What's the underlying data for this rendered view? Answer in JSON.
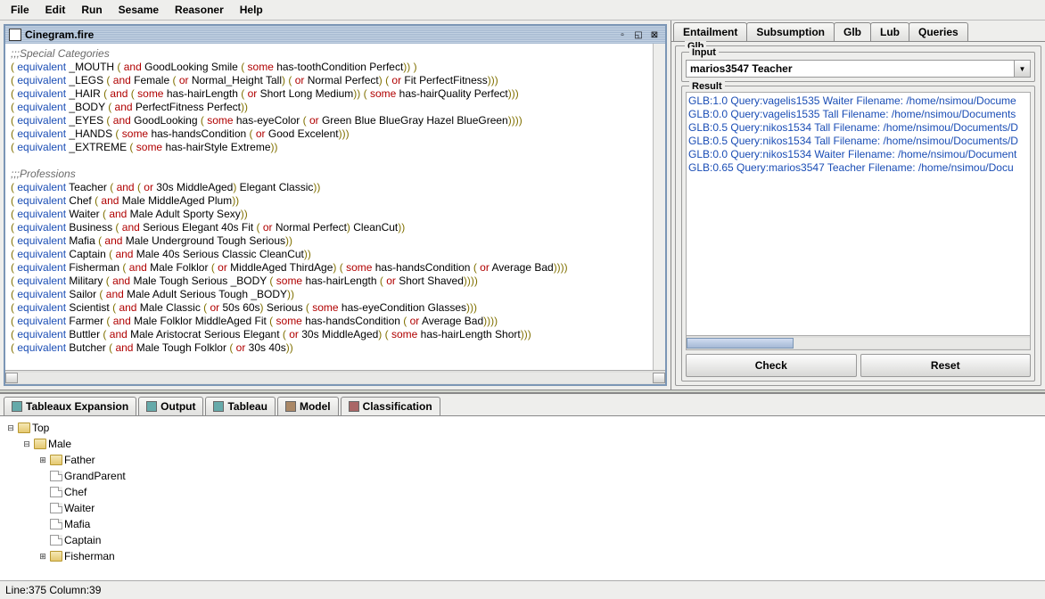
{
  "menu": [
    "File",
    "Edit",
    "Run",
    "Sesame",
    "Reasoner",
    "Help"
  ],
  "doc": {
    "title": "Cinegram.fire"
  },
  "editor_tokens": [
    [
      {
        "c": "t-comment",
        "t": ";;;Special Categories"
      }
    ],
    [
      {
        "c": "t-paren",
        "t": "( "
      },
      {
        "c": "t-kw",
        "t": "equivalent"
      },
      {
        "t": " _MOUTH "
      },
      {
        "c": "t-paren",
        "t": "( "
      },
      {
        "c": "t-op",
        "t": "and"
      },
      {
        "t": " GoodLooking Smile "
      },
      {
        "c": "t-paren",
        "t": "( "
      },
      {
        "c": "t-op",
        "t": "some"
      },
      {
        "t": " has-toothCondition Perfect"
      },
      {
        "c": "t-paren",
        "t": "))"
      },
      {
        "t": " "
      },
      {
        "c": "t-paren",
        "t": ")"
      }
    ],
    [
      {
        "c": "t-paren",
        "t": "( "
      },
      {
        "c": "t-kw",
        "t": "equivalent"
      },
      {
        "t": " _LEGS "
      },
      {
        "c": "t-paren",
        "t": "( "
      },
      {
        "c": "t-op",
        "t": "and"
      },
      {
        "t": " Female "
      },
      {
        "c": "t-paren",
        "t": "( "
      },
      {
        "c": "t-op",
        "t": "or"
      },
      {
        "t": " Normal_Height Tall"
      },
      {
        "c": "t-paren",
        "t": ")"
      },
      {
        "t": " "
      },
      {
        "c": "t-paren",
        "t": "( "
      },
      {
        "c": "t-op",
        "t": "or"
      },
      {
        "t": " Normal Perfect"
      },
      {
        "c": "t-paren",
        "t": ")"
      },
      {
        "t": " "
      },
      {
        "c": "t-paren",
        "t": "( "
      },
      {
        "c": "t-op",
        "t": "or"
      },
      {
        "t": " Fit PerfectFitness"
      },
      {
        "c": "t-paren",
        "t": ")))"
      }
    ],
    [
      {
        "c": "t-paren",
        "t": "( "
      },
      {
        "c": "t-kw",
        "t": "equivalent"
      },
      {
        "t": " _HAIR "
      },
      {
        "c": "t-paren",
        "t": "( "
      },
      {
        "c": "t-op",
        "t": "and"
      },
      {
        "t": " "
      },
      {
        "c": "t-paren",
        "t": "( "
      },
      {
        "c": "t-op",
        "t": "some"
      },
      {
        "t": " has-hairLength "
      },
      {
        "c": "t-paren",
        "t": "( "
      },
      {
        "c": "t-op",
        "t": "or"
      },
      {
        "t": " Short Long Medium"
      },
      {
        "c": "t-paren",
        "t": "))"
      },
      {
        "t": " "
      },
      {
        "c": "t-paren",
        "t": "( "
      },
      {
        "c": "t-op",
        "t": "some"
      },
      {
        "t": " has-hairQuality Perfect"
      },
      {
        "c": "t-paren",
        "t": ")))"
      }
    ],
    [
      {
        "c": "t-paren",
        "t": "( "
      },
      {
        "c": "t-kw",
        "t": "equivalent"
      },
      {
        "t": " _BODY "
      },
      {
        "c": "t-paren",
        "t": "( "
      },
      {
        "c": "t-op",
        "t": "and"
      },
      {
        "t": " PerfectFitness Perfect"
      },
      {
        "c": "t-paren",
        "t": "))"
      }
    ],
    [
      {
        "c": "t-paren",
        "t": "( "
      },
      {
        "c": "t-kw",
        "t": "equivalent"
      },
      {
        "t": " _EYES "
      },
      {
        "c": "t-paren",
        "t": "( "
      },
      {
        "c": "t-op",
        "t": "and"
      },
      {
        "t": " GoodLooking "
      },
      {
        "c": "t-paren",
        "t": "( "
      },
      {
        "c": "t-op",
        "t": "some"
      },
      {
        "t": " has-eyeColor "
      },
      {
        "c": "t-paren",
        "t": "( "
      },
      {
        "c": "t-op",
        "t": "or"
      },
      {
        "t": " Green Blue BlueGray Hazel BlueGreen"
      },
      {
        "c": "t-paren",
        "t": "))))"
      }
    ],
    [
      {
        "c": "t-paren",
        "t": "( "
      },
      {
        "c": "t-kw",
        "t": "equivalent"
      },
      {
        "t": " _HANDS "
      },
      {
        "c": "t-paren",
        "t": "( "
      },
      {
        "c": "t-op",
        "t": "some"
      },
      {
        "t": " has-handsCondition "
      },
      {
        "c": "t-paren",
        "t": "( "
      },
      {
        "c": "t-op",
        "t": "or"
      },
      {
        "t": " Good Excelent"
      },
      {
        "c": "t-paren",
        "t": ")))"
      }
    ],
    [
      {
        "c": "t-paren",
        "t": "( "
      },
      {
        "c": "t-kw",
        "t": "equivalent"
      },
      {
        "t": " _EXTREME "
      },
      {
        "c": "t-paren",
        "t": "( "
      },
      {
        "c": "t-op",
        "t": "some"
      },
      {
        "t": " has-hairStyle Extreme"
      },
      {
        "c": "t-paren",
        "t": "))"
      }
    ],
    [],
    [
      {
        "c": "t-comment",
        "t": ";;;Professions"
      }
    ],
    [
      {
        "c": "t-paren",
        "t": "( "
      },
      {
        "c": "t-kw",
        "t": "equivalent"
      },
      {
        "t": " Teacher "
      },
      {
        "c": "t-paren",
        "t": "( "
      },
      {
        "c": "t-op",
        "t": "and"
      },
      {
        "t": " "
      },
      {
        "c": "t-paren",
        "t": "( "
      },
      {
        "c": "t-op",
        "t": "or"
      },
      {
        "t": " 30s MiddleAged"
      },
      {
        "c": "t-paren",
        "t": ")"
      },
      {
        "t": " Elegant Classic"
      },
      {
        "c": "t-paren",
        "t": "))"
      }
    ],
    [
      {
        "c": "t-paren",
        "t": "( "
      },
      {
        "c": "t-kw",
        "t": "equivalent"
      },
      {
        "t": " Chef "
      },
      {
        "c": "t-paren",
        "t": "( "
      },
      {
        "c": "t-op",
        "t": "and"
      },
      {
        "t": " Male MiddleAged Plum"
      },
      {
        "c": "t-paren",
        "t": "))"
      }
    ],
    [
      {
        "c": "t-paren",
        "t": "( "
      },
      {
        "c": "t-kw",
        "t": "equivalent"
      },
      {
        "t": " Waiter "
      },
      {
        "c": "t-paren",
        "t": "( "
      },
      {
        "c": "t-op",
        "t": "and"
      },
      {
        "t": " Male Adult Sporty Sexy"
      },
      {
        "c": "t-paren",
        "t": "))"
      }
    ],
    [
      {
        "c": "t-paren",
        "t": "( "
      },
      {
        "c": "t-kw",
        "t": "equivalent"
      },
      {
        "t": " Business "
      },
      {
        "c": "t-paren",
        "t": "( "
      },
      {
        "c": "t-op",
        "t": "and"
      },
      {
        "t": " Serious Elegant 40s  Fit "
      },
      {
        "c": "t-paren",
        "t": "( "
      },
      {
        "c": "t-op",
        "t": "or"
      },
      {
        "t": " Normal Perfect"
      },
      {
        "c": "t-paren",
        "t": ")"
      },
      {
        "t": " CleanCut"
      },
      {
        "c": "t-paren",
        "t": "))"
      }
    ],
    [
      {
        "c": "t-paren",
        "t": "( "
      },
      {
        "c": "t-kw",
        "t": "equivalent"
      },
      {
        "t": " Mafia "
      },
      {
        "c": "t-paren",
        "t": "( "
      },
      {
        "c": "t-op",
        "t": "and"
      },
      {
        "t": " Male Underground Tough Serious"
      },
      {
        "c": "t-paren",
        "t": "))"
      }
    ],
    [
      {
        "c": "t-paren",
        "t": "( "
      },
      {
        "c": "t-kw",
        "t": "equivalent"
      },
      {
        "t": " Captain "
      },
      {
        "c": "t-paren",
        "t": "( "
      },
      {
        "c": "t-op",
        "t": "and"
      },
      {
        "t": " Male 40s Serious Classic CleanCut"
      },
      {
        "c": "t-paren",
        "t": "))"
      }
    ],
    [
      {
        "c": "t-paren",
        "t": "( "
      },
      {
        "c": "t-kw",
        "t": "equivalent"
      },
      {
        "t": " Fisherman "
      },
      {
        "c": "t-paren",
        "t": "( "
      },
      {
        "c": "t-op",
        "t": "and"
      },
      {
        "t": " Male Folklor "
      },
      {
        "c": "t-paren",
        "t": "( "
      },
      {
        "c": "t-op",
        "t": "or"
      },
      {
        "t": " MiddleAged ThirdAge"
      },
      {
        "c": "t-paren",
        "t": ")"
      },
      {
        "t": " "
      },
      {
        "c": "t-paren",
        "t": "( "
      },
      {
        "c": "t-op",
        "t": "some"
      },
      {
        "t": " has-handsCondition "
      },
      {
        "c": "t-paren",
        "t": "( "
      },
      {
        "c": "t-op",
        "t": "or"
      },
      {
        "t": " Average Bad"
      },
      {
        "c": "t-paren",
        "t": "))))"
      }
    ],
    [
      {
        "c": "t-paren",
        "t": "( "
      },
      {
        "c": "t-kw",
        "t": "equivalent"
      },
      {
        "t": " Military "
      },
      {
        "c": "t-paren",
        "t": "( "
      },
      {
        "c": "t-op",
        "t": "and"
      },
      {
        "t": " Male Tough Serious _BODY "
      },
      {
        "c": "t-paren",
        "t": "( "
      },
      {
        "c": "t-op",
        "t": "some"
      },
      {
        "t": " has-hairLength "
      },
      {
        "c": "t-paren",
        "t": "( "
      },
      {
        "c": "t-op",
        "t": "or"
      },
      {
        "t": " Short Shaved"
      },
      {
        "c": "t-paren",
        "t": "))))"
      }
    ],
    [
      {
        "c": "t-paren",
        "t": "( "
      },
      {
        "c": "t-kw",
        "t": "equivalent"
      },
      {
        "t": " Sailor "
      },
      {
        "c": "t-paren",
        "t": "( "
      },
      {
        "c": "t-op",
        "t": "and"
      },
      {
        "t": " Male Adult Serious Tough _BODY"
      },
      {
        "c": "t-paren",
        "t": "))"
      }
    ],
    [
      {
        "c": "t-paren",
        "t": "( "
      },
      {
        "c": "t-kw",
        "t": "equivalent"
      },
      {
        "t": " Scientist "
      },
      {
        "c": "t-paren",
        "t": "( "
      },
      {
        "c": "t-op",
        "t": "and"
      },
      {
        "t": " Male Classic "
      },
      {
        "c": "t-paren",
        "t": "( "
      },
      {
        "c": "t-op",
        "t": "or"
      },
      {
        "t": " 50s 60s"
      },
      {
        "c": "t-paren",
        "t": ")"
      },
      {
        "t": " Serious "
      },
      {
        "c": "t-paren",
        "t": "( "
      },
      {
        "c": "t-op",
        "t": "some"
      },
      {
        "t": " has-eyeCondition Glasses"
      },
      {
        "c": "t-paren",
        "t": ")))"
      }
    ],
    [
      {
        "c": "t-paren",
        "t": "( "
      },
      {
        "c": "t-kw",
        "t": "equivalent"
      },
      {
        "t": " Farmer "
      },
      {
        "c": "t-paren",
        "t": "( "
      },
      {
        "c": "t-op",
        "t": "and"
      },
      {
        "t": " Male Folklor MiddleAged Fit "
      },
      {
        "c": "t-paren",
        "t": "( "
      },
      {
        "c": "t-op",
        "t": "some"
      },
      {
        "t": " has-handsCondition "
      },
      {
        "c": "t-paren",
        "t": "( "
      },
      {
        "c": "t-op",
        "t": "or"
      },
      {
        "t": " Average Bad"
      },
      {
        "c": "t-paren",
        "t": "))))"
      }
    ],
    [
      {
        "c": "t-paren",
        "t": "( "
      },
      {
        "c": "t-kw",
        "t": "equivalent"
      },
      {
        "t": " Buttler "
      },
      {
        "c": "t-paren",
        "t": "( "
      },
      {
        "c": "t-op",
        "t": "and"
      },
      {
        "t": " Male Aristocrat Serious Elegant "
      },
      {
        "c": "t-paren",
        "t": "( "
      },
      {
        "c": "t-op",
        "t": "or"
      },
      {
        "t": " 30s MiddleAged"
      },
      {
        "c": "t-paren",
        "t": ")"
      },
      {
        "t": " "
      },
      {
        "c": "t-paren",
        "t": "( "
      },
      {
        "c": "t-op",
        "t": "some"
      },
      {
        "t": " has-hairLength Short"
      },
      {
        "c": "t-paren",
        "t": ")))"
      }
    ],
    [
      {
        "c": "t-paren",
        "t": "( "
      },
      {
        "c": "t-kw",
        "t": "equivalent"
      },
      {
        "t": " Butcher "
      },
      {
        "c": "t-paren",
        "t": "( "
      },
      {
        "c": "t-op",
        "t": "and"
      },
      {
        "t": " Male Tough Folklor "
      },
      {
        "c": "t-paren",
        "t": "( "
      },
      {
        "c": "t-op",
        "t": "or"
      },
      {
        "t": " 30s 40s"
      },
      {
        "c": "t-paren",
        "t": "))"
      }
    ]
  ],
  "right_tabs": [
    "Entailment",
    "Subsumption",
    "Glb",
    "Lub",
    "Queries"
  ],
  "glb": {
    "group_label": "Glb",
    "input_label": "Input",
    "input_value": "marios3547 Teacher",
    "result_label": "Result",
    "results": [
      "GLB:1.0   Query:vagelis1535 Waiter Filename: /home/nsimou/Docume",
      "GLB:0.0   Query:vagelis1535 Tall Filename: /home/nsimou/Documents",
      "GLB:0.5   Query:nikos1534 Tall Filename: /home/nsimou/Documents/D",
      "GLB:0.5   Query:nikos1534 Tall Filename: /home/nsimou/Documents/D",
      "GLB:0.0   Query:nikos1534 Waiter Filename: /home/nsimou/Document",
      "GLB:0.65  Query:marios3547 Teacher Filename: /home/nsimou/Docu"
    ],
    "check_label": "Check",
    "reset_label": "Reset"
  },
  "bottom_tabs": [
    "Tableaux Expansion",
    "Output",
    "Tableau",
    "Model",
    "Classification"
  ],
  "tree": {
    "root": "Top",
    "male": "Male",
    "children": [
      "Father",
      "GrandParent",
      "Chef",
      "Waiter",
      "Mafia",
      "Captain",
      "Fisherman"
    ]
  },
  "status": "Line:375 Column:39"
}
